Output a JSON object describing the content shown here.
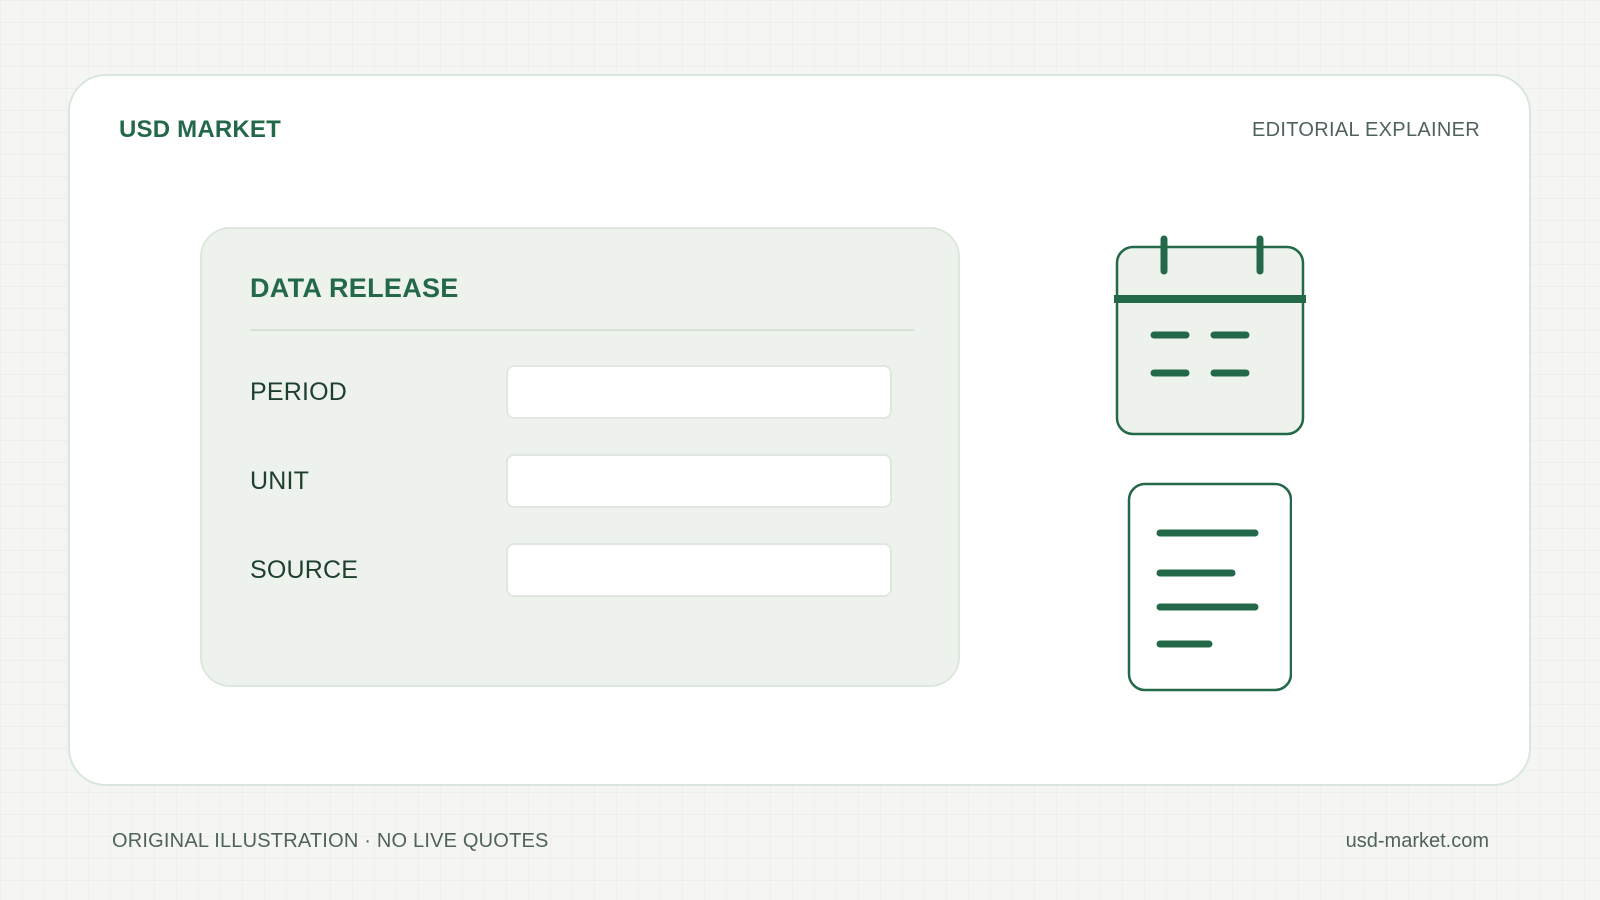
{
  "header": {
    "brand": "USD MARKET",
    "tagline": "EDITORIAL EXPLAINER"
  },
  "panel": {
    "title": "DATA RELEASE",
    "fields": [
      {
        "label": "PERIOD",
        "value": ""
      },
      {
        "label": "UNIT",
        "value": ""
      },
      {
        "label": "SOURCE",
        "value": ""
      }
    ]
  },
  "icons": [
    "calendar-icon",
    "document-icon"
  ],
  "footer": {
    "note": "ORIGINAL ILLUSTRATION · NO LIVE QUOTES",
    "domain": "usd-market.com"
  },
  "colors": {
    "accent": "#24684a",
    "panel_bg": "#edf2ec",
    "page_bg": "#f5f6f3"
  }
}
